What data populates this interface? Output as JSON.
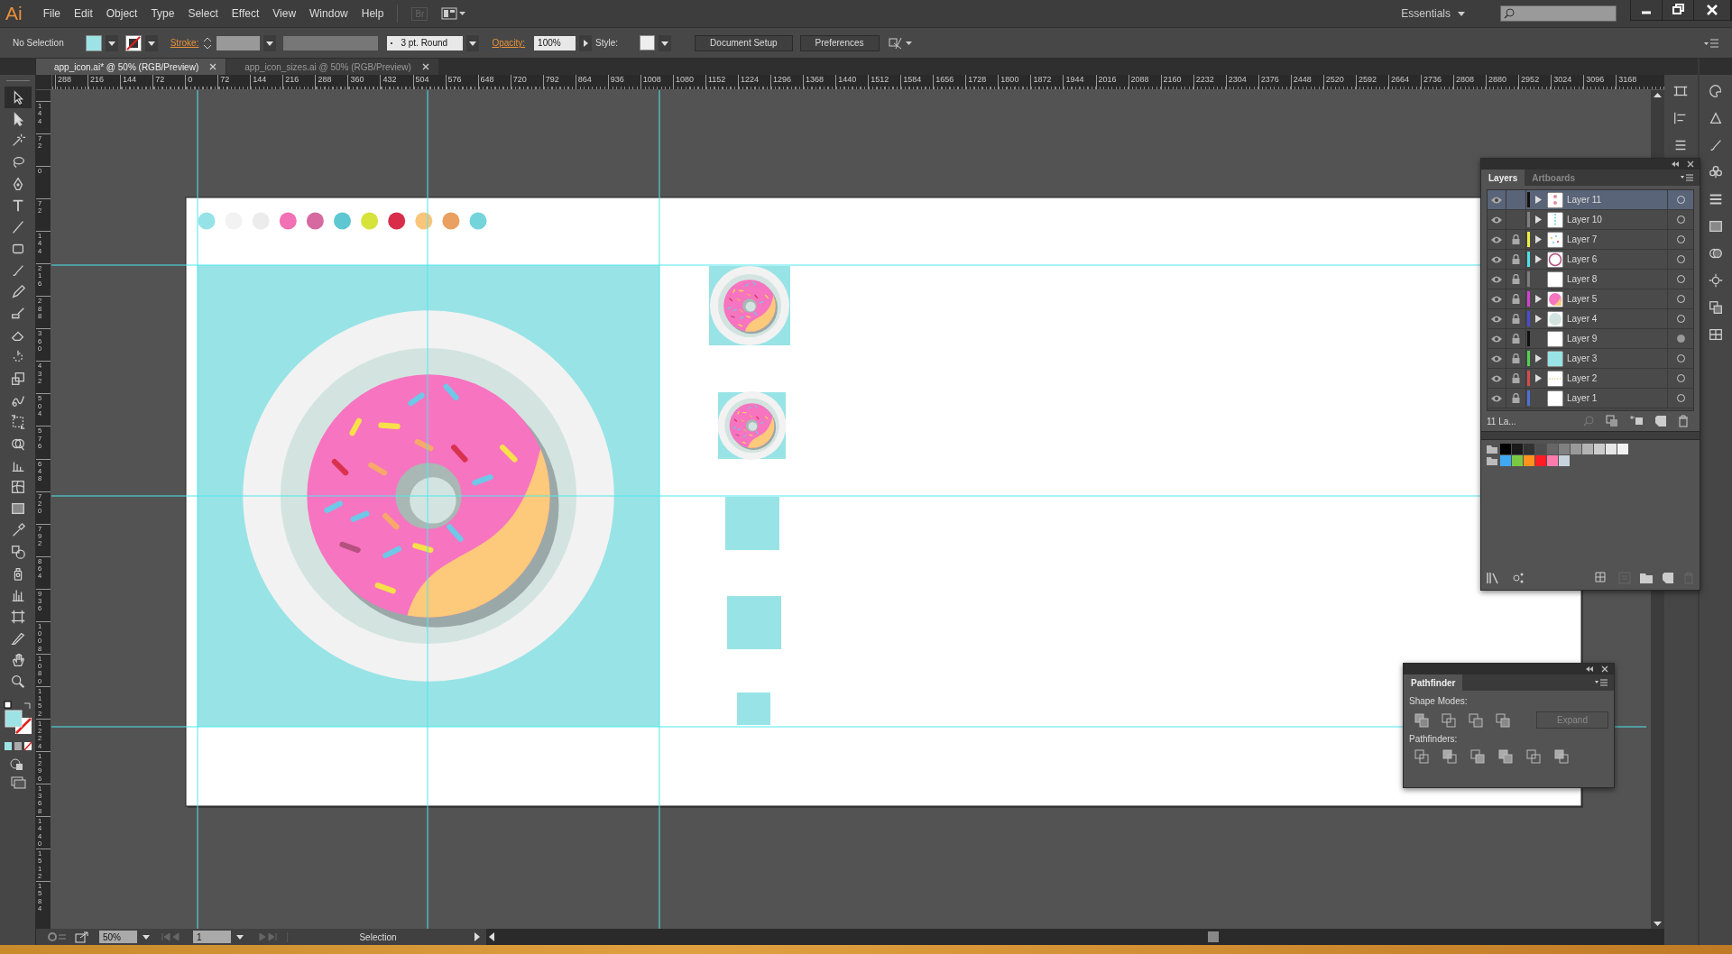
{
  "menu_bar": {
    "logo": "Ai",
    "menu": [
      "File",
      "Edit",
      "Object",
      "Type",
      "Select",
      "Effect",
      "View",
      "Window",
      "Help"
    ],
    "bridge": "Br",
    "workspace": "Essentials"
  },
  "control_bar": {
    "selection": "No Selection",
    "stroke_label": "Stroke:",
    "brush": "3 pt. Round",
    "opacity_label": "Opacity:",
    "opacity": "100%",
    "style_label": "Style:",
    "buttons": [
      "Document Setup",
      "Preferences"
    ]
  },
  "document_tabs": [
    {
      "title": "app_icon.ai* @ 50% (RGB/Preview)",
      "selected": true
    },
    {
      "title": "app_icon_sizes.ai @ 50% (RGB/Preview)",
      "selected": false
    }
  ],
  "rulers": {
    "horizontal": [
      "288",
      "216",
      "144",
      "72",
      "0",
      "72",
      "144",
      "216",
      "288",
      "360",
      "432",
      "504",
      "576",
      "648",
      "720",
      "792",
      "864",
      "936",
      "1008",
      "1080",
      "1152",
      "1224",
      "1296",
      "1368",
      "1440",
      "1512",
      "1584",
      "1656",
      "1728",
      "1800",
      "1872",
      "1944",
      "2016",
      "2088",
      "2160",
      "2232",
      "2304",
      "2376",
      "2448",
      "2520",
      "2592",
      "2664",
      "2736",
      "2808",
      "2880",
      "2952",
      "3024",
      "3096",
      "3168"
    ],
    "vertical": [
      "144",
      "72",
      "0",
      "72",
      "144",
      "216",
      "288",
      "360",
      "432",
      "504",
      "576",
      "648",
      "720",
      "792",
      "864",
      "936",
      "1008",
      "1080",
      "1152",
      "1224",
      "1296",
      "1368",
      "1440",
      "1512",
      "1584"
    ]
  },
  "tools": [
    {
      "selected": true
    },
    {
      "selected": false
    },
    {
      "selected": false
    },
    {
      "selected": false
    },
    {
      "selected": false
    },
    {
      "selected": false
    },
    {
      "selected": false
    },
    {
      "selected": false
    },
    {
      "selected": false
    },
    {
      "selected": false
    },
    {
      "selected": false
    },
    {
      "selected": false
    },
    {
      "selected": false
    },
    {
      "selected": false
    },
    {
      "selected": false
    },
    {
      "selected": false
    },
    {
      "selected": false
    },
    {
      "selected": false
    },
    {
      "selected": false
    },
    {
      "selected": false
    },
    {
      "selected": false
    },
    {
      "selected": false
    },
    {
      "selected": false
    },
    {
      "selected": false
    },
    {
      "selected": false
    },
    {
      "selected": false
    },
    {
      "selected": false
    },
    {
      "selected": false
    }
  ],
  "artboard": {
    "swatch_dots": [
      {
        "color": "#95e3e6"
      },
      {
        "color": "#f2f2f2"
      },
      {
        "color": "#ececec"
      },
      {
        "color": "#f270b4"
      },
      {
        "color": "#d66aa0"
      },
      {
        "color": "#5ec7d2"
      },
      {
        "color": "#d6e33a"
      },
      {
        "color": "#d92d4a"
      },
      {
        "color": "#f9c57a"
      },
      {
        "color": "#e9a060"
      },
      {
        "color": "#74d4db"
      }
    ]
  },
  "layers_panel": {
    "tabs": [
      {
        "label": "Layers",
        "selected": true
      },
      {
        "label": "Artboards",
        "selected": false
      }
    ],
    "layers": [
      {
        "name": "Layer 11",
        "color": "#111111",
        "locked": false,
        "expandable": true,
        "selected": true,
        "targeted": false,
        "kind": "dots"
      },
      {
        "name": "Layer 10",
        "color": "#808080",
        "locked": false,
        "expandable": true,
        "selected": false,
        "targeted": false,
        "kind": "column"
      },
      {
        "name": "Layer 7",
        "color": "#f0f040",
        "locked": true,
        "expandable": true,
        "selected": false,
        "targeted": false,
        "kind": "sprinkles"
      },
      {
        "name": "Layer 6",
        "color": "#4fe0e8",
        "locked": true,
        "expandable": true,
        "selected": false,
        "targeted": false,
        "kind": "ring"
      },
      {
        "name": "Layer 8",
        "color": "#7f7f7f",
        "locked": true,
        "expandable": false,
        "selected": false,
        "targeted": false,
        "kind": "blank"
      },
      {
        "name": "Layer 5",
        "color": "#d43ed4",
        "locked": true,
        "expandable": true,
        "selected": false,
        "targeted": false,
        "kind": "donut"
      },
      {
        "name": "Layer 4",
        "color": "#4a4ad8",
        "locked": true,
        "expandable": true,
        "selected": false,
        "targeted": false,
        "kind": "disc"
      },
      {
        "name": "Layer 9",
        "color": "#101010",
        "locked": true,
        "expandable": false,
        "selected": false,
        "targeted": true,
        "kind": "blank"
      },
      {
        "name": "Layer 3",
        "color": "#4fd44f",
        "locked": true,
        "expandable": true,
        "selected": false,
        "targeted": false,
        "kind": "fill"
      },
      {
        "name": "Layer 2",
        "color": "#d84a4a",
        "locked": true,
        "expandable": true,
        "selected": false,
        "targeted": false,
        "kind": "line"
      },
      {
        "name": "Layer 1",
        "color": "#4f6fd8",
        "locked": true,
        "expandable": false,
        "selected": false,
        "targeted": false,
        "kind": "blank"
      }
    ],
    "count": "11 La...",
    "swatch_rows": [
      [
        {
          "color": "#000000"
        },
        {
          "color": "#1a1a1a"
        },
        {
          "color": "#333333"
        },
        {
          "color": "#4d4d4d"
        },
        {
          "color": "#666666"
        },
        {
          "color": "#808080"
        },
        {
          "color": "#999999"
        },
        {
          "color": "#b3b3b3"
        },
        {
          "color": "#cccccc"
        },
        {
          "color": "#e6e6e6"
        },
        {
          "color": "#f2f2f2"
        }
      ],
      [
        {
          "color": "#3fa9f5"
        },
        {
          "color": "#7ac943"
        },
        {
          "color": "#ff931e"
        },
        {
          "color": "#ff1d25"
        },
        {
          "color": "#ff7bac"
        },
        {
          "color": "#c7d3dd"
        }
      ]
    ]
  },
  "pathfinder": {
    "title": "Pathfinder",
    "shape_modes_label": "Shape Modes:",
    "expand": {
      "label": "Expand",
      "disabled": true
    },
    "pathfinders_label": "Pathfinders:"
  },
  "status_bar": {
    "zoom": "50%",
    "artboard": "1",
    "tool": "Selection"
  }
}
